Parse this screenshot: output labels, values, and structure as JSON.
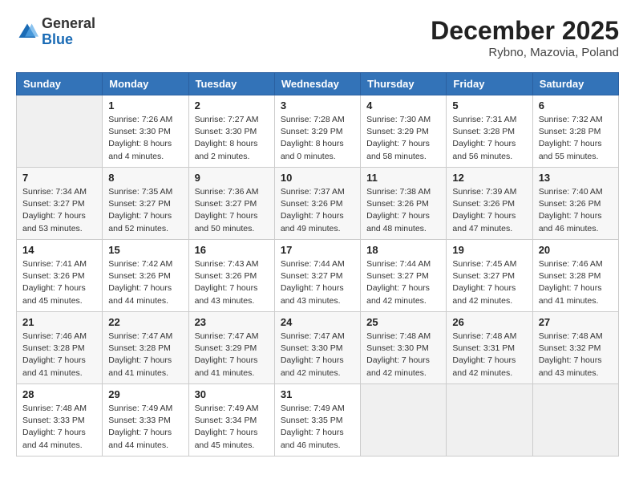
{
  "header": {
    "logo": {
      "general": "General",
      "blue": "Blue"
    },
    "title": "December 2025",
    "subtitle": "Rybno, Mazovia, Poland"
  },
  "calendar": {
    "days_of_week": [
      "Sunday",
      "Monday",
      "Tuesday",
      "Wednesday",
      "Thursday",
      "Friday",
      "Saturday"
    ],
    "weeks": [
      [
        {
          "day": "",
          "info": ""
        },
        {
          "day": "1",
          "info": "Sunrise: 7:26 AM\nSunset: 3:30 PM\nDaylight: 8 hours\nand 4 minutes."
        },
        {
          "day": "2",
          "info": "Sunrise: 7:27 AM\nSunset: 3:30 PM\nDaylight: 8 hours\nand 2 minutes."
        },
        {
          "day": "3",
          "info": "Sunrise: 7:28 AM\nSunset: 3:29 PM\nDaylight: 8 hours\nand 0 minutes."
        },
        {
          "day": "4",
          "info": "Sunrise: 7:30 AM\nSunset: 3:29 PM\nDaylight: 7 hours\nand 58 minutes."
        },
        {
          "day": "5",
          "info": "Sunrise: 7:31 AM\nSunset: 3:28 PM\nDaylight: 7 hours\nand 56 minutes."
        },
        {
          "day": "6",
          "info": "Sunrise: 7:32 AM\nSunset: 3:28 PM\nDaylight: 7 hours\nand 55 minutes."
        }
      ],
      [
        {
          "day": "7",
          "info": "Sunrise: 7:34 AM\nSunset: 3:27 PM\nDaylight: 7 hours\nand 53 minutes."
        },
        {
          "day": "8",
          "info": "Sunrise: 7:35 AM\nSunset: 3:27 PM\nDaylight: 7 hours\nand 52 minutes."
        },
        {
          "day": "9",
          "info": "Sunrise: 7:36 AM\nSunset: 3:27 PM\nDaylight: 7 hours\nand 50 minutes."
        },
        {
          "day": "10",
          "info": "Sunrise: 7:37 AM\nSunset: 3:26 PM\nDaylight: 7 hours\nand 49 minutes."
        },
        {
          "day": "11",
          "info": "Sunrise: 7:38 AM\nSunset: 3:26 PM\nDaylight: 7 hours\nand 48 minutes."
        },
        {
          "day": "12",
          "info": "Sunrise: 7:39 AM\nSunset: 3:26 PM\nDaylight: 7 hours\nand 47 minutes."
        },
        {
          "day": "13",
          "info": "Sunrise: 7:40 AM\nSunset: 3:26 PM\nDaylight: 7 hours\nand 46 minutes."
        }
      ],
      [
        {
          "day": "14",
          "info": "Sunrise: 7:41 AM\nSunset: 3:26 PM\nDaylight: 7 hours\nand 45 minutes."
        },
        {
          "day": "15",
          "info": "Sunrise: 7:42 AM\nSunset: 3:26 PM\nDaylight: 7 hours\nand 44 minutes."
        },
        {
          "day": "16",
          "info": "Sunrise: 7:43 AM\nSunset: 3:26 PM\nDaylight: 7 hours\nand 43 minutes."
        },
        {
          "day": "17",
          "info": "Sunrise: 7:44 AM\nSunset: 3:27 PM\nDaylight: 7 hours\nand 43 minutes."
        },
        {
          "day": "18",
          "info": "Sunrise: 7:44 AM\nSunset: 3:27 PM\nDaylight: 7 hours\nand 42 minutes."
        },
        {
          "day": "19",
          "info": "Sunrise: 7:45 AM\nSunset: 3:27 PM\nDaylight: 7 hours\nand 42 minutes."
        },
        {
          "day": "20",
          "info": "Sunrise: 7:46 AM\nSunset: 3:28 PM\nDaylight: 7 hours\nand 41 minutes."
        }
      ],
      [
        {
          "day": "21",
          "info": "Sunrise: 7:46 AM\nSunset: 3:28 PM\nDaylight: 7 hours\nand 41 minutes."
        },
        {
          "day": "22",
          "info": "Sunrise: 7:47 AM\nSunset: 3:28 PM\nDaylight: 7 hours\nand 41 minutes."
        },
        {
          "day": "23",
          "info": "Sunrise: 7:47 AM\nSunset: 3:29 PM\nDaylight: 7 hours\nand 41 minutes."
        },
        {
          "day": "24",
          "info": "Sunrise: 7:47 AM\nSunset: 3:30 PM\nDaylight: 7 hours\nand 42 minutes."
        },
        {
          "day": "25",
          "info": "Sunrise: 7:48 AM\nSunset: 3:30 PM\nDaylight: 7 hours\nand 42 minutes."
        },
        {
          "day": "26",
          "info": "Sunrise: 7:48 AM\nSunset: 3:31 PM\nDaylight: 7 hours\nand 42 minutes."
        },
        {
          "day": "27",
          "info": "Sunrise: 7:48 AM\nSunset: 3:32 PM\nDaylight: 7 hours\nand 43 minutes."
        }
      ],
      [
        {
          "day": "28",
          "info": "Sunrise: 7:48 AM\nSunset: 3:33 PM\nDaylight: 7 hours\nand 44 minutes."
        },
        {
          "day": "29",
          "info": "Sunrise: 7:49 AM\nSunset: 3:33 PM\nDaylight: 7 hours\nand 44 minutes."
        },
        {
          "day": "30",
          "info": "Sunrise: 7:49 AM\nSunset: 3:34 PM\nDaylight: 7 hours\nand 45 minutes."
        },
        {
          "day": "31",
          "info": "Sunrise: 7:49 AM\nSunset: 3:35 PM\nDaylight: 7 hours\nand 46 minutes."
        },
        {
          "day": "",
          "info": ""
        },
        {
          "day": "",
          "info": ""
        },
        {
          "day": "",
          "info": ""
        }
      ]
    ]
  }
}
